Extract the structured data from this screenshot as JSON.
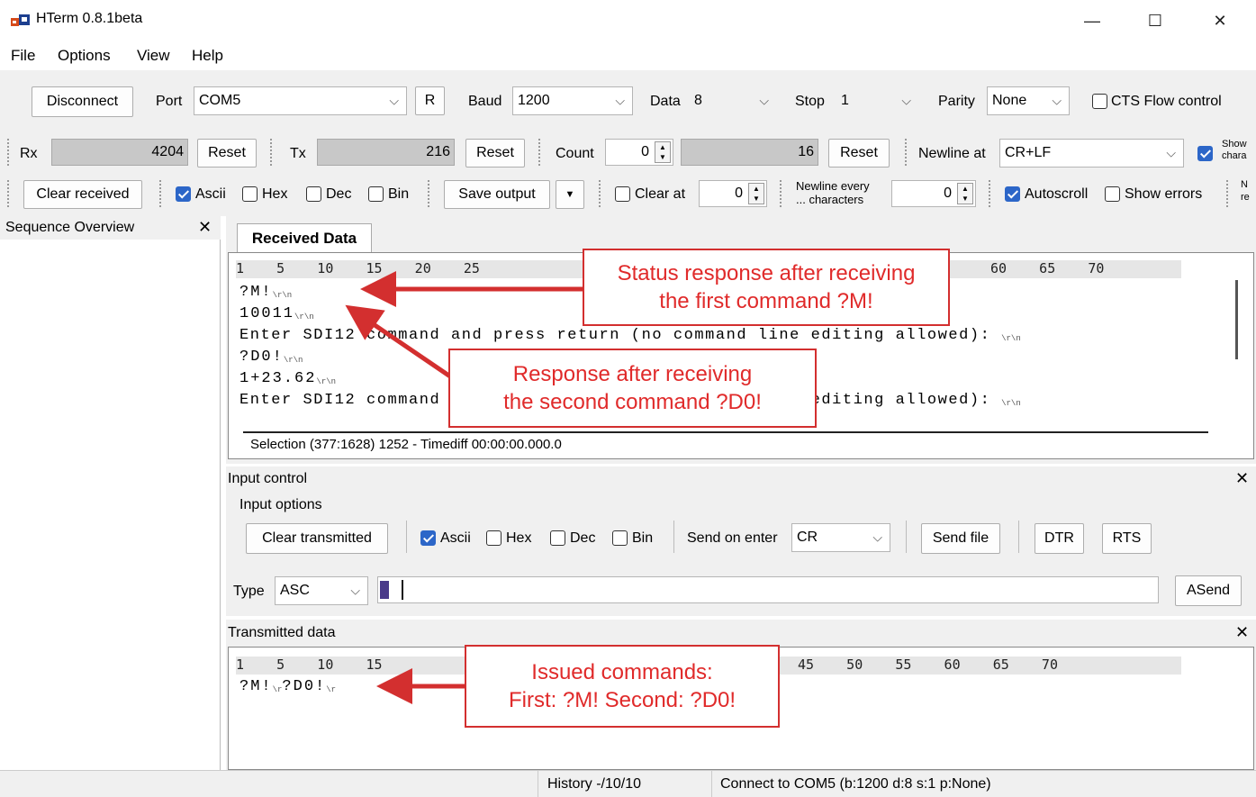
{
  "window": {
    "title": "HTerm 0.8.1beta",
    "minimize": "—",
    "maximize": "☐",
    "close": "✕"
  },
  "menu": [
    "File",
    "Options",
    "View",
    "Help"
  ],
  "connection": {
    "disconnect": "Disconnect",
    "port_label": "Port",
    "port_value": "COM5",
    "refresh": "R",
    "baud_label": "Baud",
    "baud_value": "1200",
    "data_label": "Data",
    "data_value": "8",
    "stop_label": "Stop",
    "stop_value": "1",
    "parity_label": "Parity",
    "parity_value": "None",
    "cts_label": "CTS Flow control"
  },
  "counters": {
    "rx_label": "Rx",
    "rx_value": "4204",
    "rx_reset": "Reset",
    "tx_label": "Tx",
    "tx_value": "216",
    "tx_reset": "Reset",
    "count_label": "Count",
    "count_value": "0",
    "count_total": "16",
    "count_reset": "Reset",
    "newline_label": "Newline at",
    "newline_value": "CR+LF",
    "show_label_1": "Show",
    "show_label_2": "chara"
  },
  "receive_options": {
    "clear_received": "Clear received",
    "ascii": "Ascii",
    "hex": "Hex",
    "dec": "Dec",
    "bin": "Bin",
    "save_output": "Save output",
    "clear_at": "Clear at",
    "clear_at_value": "0",
    "newline_every_1": "Newline every",
    "newline_every_2": "... characters",
    "newline_every_value": "0",
    "autoscroll": "Autoscroll",
    "show_errors": "Show errors",
    "cut_1": "N",
    "cut_2": "re"
  },
  "sequence_overview": {
    "title": "Sequence Overview",
    "close": "✕"
  },
  "received": {
    "tab": "Received Data",
    "ruler": "1    5    10    15    20    25",
    "ruler_right": "60    65    70",
    "lines": [
      "?M!",
      "10011",
      "Enter SDI12 command and press return (no command line editing allowed): ",
      "?D0!",
      "1+23.62",
      "Enter SDI12 command and press return (no command line editing allowed): "
    ],
    "ctl": "\\r\\n",
    "selection": "Selection (377:1628) 1252  -  Timediff 00:00:00.000.0"
  },
  "input_control": {
    "title": "Input control",
    "close": "✕",
    "options_title": "Input options",
    "clear_transmitted": "Clear transmitted",
    "ascii": "Ascii",
    "hex": "Hex",
    "dec": "Dec",
    "bin": "Bin",
    "send_on_enter_label": "Send on enter",
    "send_on_enter_value": "CR",
    "send_file": "Send file",
    "dtr": "DTR",
    "rts": "RTS",
    "type_label": "Type",
    "type_value": "ASC",
    "asend": "ASend"
  },
  "transmitted": {
    "title": "Transmitted data",
    "close": "✕",
    "ruler_left": "1    5    10    15",
    "ruler_right": "45    50    55    60    65    70",
    "line": "?M!",
    "line2": "?D0!",
    "ctl": "\\r"
  },
  "annotations": {
    "status": [
      "Status response after receiving",
      "the first command ?M!"
    ],
    "response": [
      "Response after receiving",
      "the second command ?D0!"
    ],
    "issued": [
      "Issued commands:",
      "First: ?M!  Second: ?D0!"
    ],
    "color": "#d32f2f"
  },
  "statusbar": {
    "history": "History -/10/10",
    "connect": "Connect to COM5 (b:1200 d:8 s:1 p:None)"
  }
}
